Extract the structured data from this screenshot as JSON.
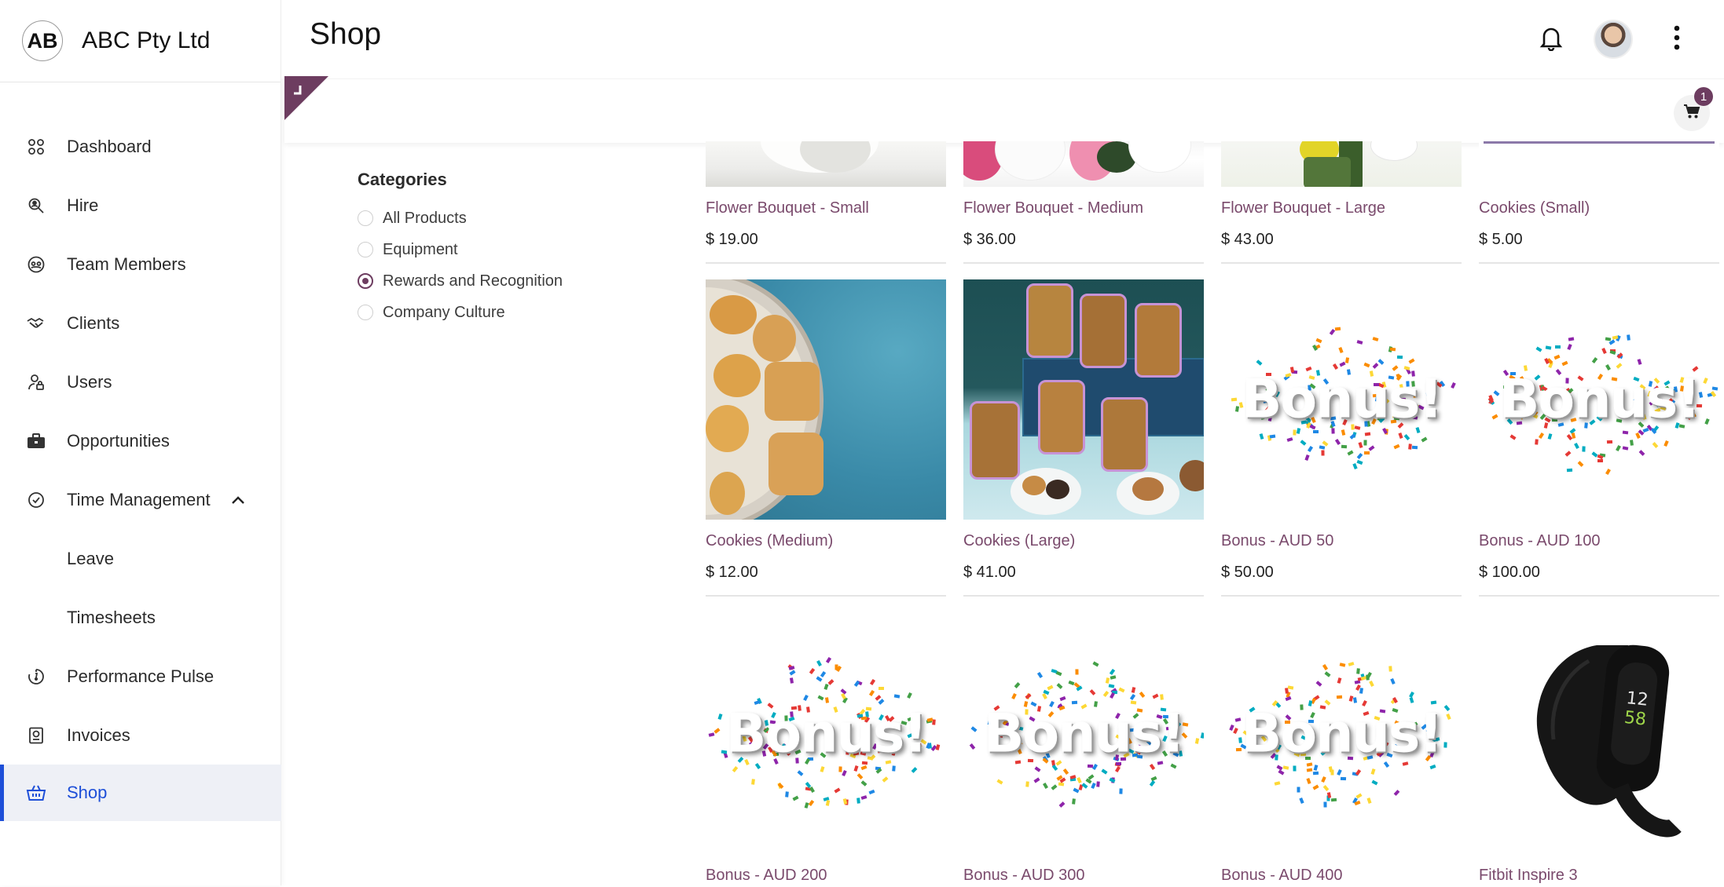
{
  "brand": {
    "logo_text": "AB",
    "name": "ABC Pty Ltd"
  },
  "sidebar": {
    "items": [
      {
        "label": "Dashboard",
        "icon": "dashboard-icon"
      },
      {
        "label": "Hire",
        "icon": "search-person-icon"
      },
      {
        "label": "Team Members",
        "icon": "team-icon"
      },
      {
        "label": "Clients",
        "icon": "handshake-icon"
      },
      {
        "label": "Users",
        "icon": "user-lock-icon"
      },
      {
        "label": "Opportunities",
        "icon": "briefcase-icon"
      },
      {
        "label": "Time Management",
        "icon": "clock-check-icon",
        "expanded": true
      },
      {
        "label": "Leave",
        "sub": true
      },
      {
        "label": "Timesheets",
        "sub": true
      },
      {
        "label": "Performance Pulse",
        "icon": "gauge-icon"
      },
      {
        "label": "Invoices",
        "icon": "invoice-icon"
      },
      {
        "label": "Shop",
        "icon": "basket-icon",
        "active": true
      }
    ]
  },
  "header": {
    "title": "Shop",
    "notification_icon": "bell-icon",
    "menu_icon": "more-vertical-icon"
  },
  "cart": {
    "count": "1",
    "icon": "cart-icon"
  },
  "categories": {
    "title": "Categories",
    "options": [
      "All Products",
      "Equipment",
      "Rewards and Recognition",
      "Company Culture"
    ],
    "selected": "Rewards and Recognition"
  },
  "products": [
    {
      "name": "Flower Bouquet - Small",
      "price": "$ 19.00"
    },
    {
      "name": "Flower Bouquet - Medium",
      "price": "$ 36.00"
    },
    {
      "name": "Flower Bouquet - Large",
      "price": "$ 43.00"
    },
    {
      "name": "Cookies (Small)",
      "price": "$ 5.00"
    },
    {
      "name": "Cookies (Medium)",
      "price": "$ 12.00"
    },
    {
      "name": "Cookies (Large)",
      "price": "$ 41.00"
    },
    {
      "name": "Bonus - AUD 50",
      "price": "$ 50.00"
    },
    {
      "name": "Bonus - AUD 100",
      "price": "$ 100.00"
    },
    {
      "name": "Bonus - AUD 200"
    },
    {
      "name": "Bonus - AUD 300"
    },
    {
      "name": "Bonus - AUD 400"
    },
    {
      "name": "Fitbit Inspire 3"
    }
  ],
  "bonus_image_text": "Bonus!",
  "fitbit_display": {
    "hour": "12",
    "minute": "58"
  },
  "colors": {
    "accent": "#6d3d60",
    "active_nav": "#1e4fd8",
    "product_name": "#7a4a6c"
  }
}
